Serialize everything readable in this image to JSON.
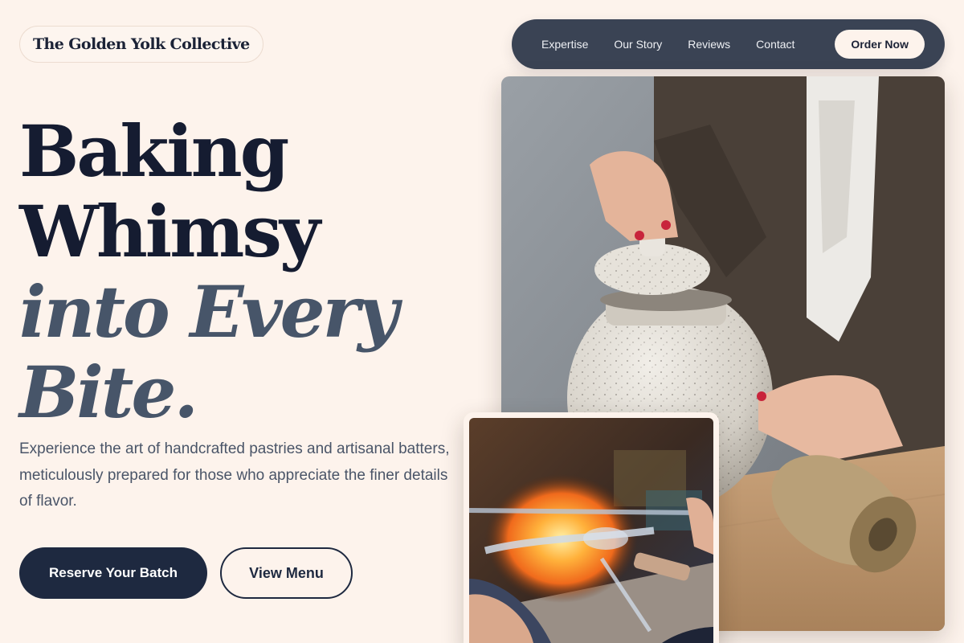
{
  "brand": {
    "name": "The Golden Yolk Collective"
  },
  "nav": {
    "links": [
      "Expertise",
      "Our Story",
      "Reviews",
      "Contact"
    ],
    "cta_label": "Order Now"
  },
  "hero": {
    "headline_line1": "Baking",
    "headline_line2": "Whimsy",
    "headline_line3": "into Every",
    "headline_line4": "Bite.",
    "description": "Experience the art of handcrafted pastries and artisanal batters, meticulously prepared for those who appreciate the finer details of flavor.",
    "primary_button": "Reserve Your Batch",
    "secondary_button": "View Menu"
  },
  "images": {
    "main_image_icon": "pottery-jar-photo",
    "inset_image_icon": "glassblowing-photo"
  },
  "colors": {
    "background": "#fdf3ec",
    "nav_background": "#3a4354",
    "primary_dark": "#1e2940",
    "headline_muted": "#475569"
  }
}
